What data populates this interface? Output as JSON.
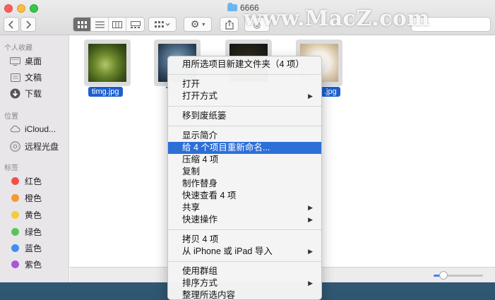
{
  "window": {
    "title": "6666",
    "watermark": "www.MacZ.com"
  },
  "toolbar": {
    "back_icon": "chevron-left-icon",
    "forward_icon": "chevron-right-icon",
    "view_modes": [
      "icon-view-icon",
      "list-view-icon",
      "column-view-icon",
      "gallery-view-icon"
    ],
    "active_view": 0
  },
  "sidebar": {
    "favorites_header": "个人收藏",
    "favorites": [
      {
        "label": "桌面",
        "icon": "desktop-icon"
      },
      {
        "label": "文稿",
        "icon": "document-icon"
      },
      {
        "label": "下载",
        "icon": "download-icon"
      }
    ],
    "locations_header": "位置",
    "locations": [
      {
        "label": "iCloud...",
        "icon": "cloud-icon"
      },
      {
        "label": "远程光盘",
        "icon": "disc-icon"
      }
    ],
    "tags_header": "标签",
    "tags": [
      {
        "label": "红色",
        "color": "#f1504a"
      },
      {
        "label": "橙色",
        "color": "#f59a2f"
      },
      {
        "label": "黄色",
        "color": "#f3cd3b"
      },
      {
        "label": "绿色",
        "color": "#5ac45a"
      },
      {
        "label": "蓝色",
        "color": "#3f8ef0"
      },
      {
        "label": "紫色",
        "color": "#a857d6"
      }
    ]
  },
  "files": [
    {
      "label": "timg.jpg"
    },
    {
      "label": ""
    },
    {
      "label": ""
    },
    {
      "label": ".jpg"
    }
  ],
  "context_menu": {
    "new_folder": "用所选项目新建文件夹（4 项）",
    "open": "打开",
    "open_with": "打开方式",
    "move_to_trash": "移到废纸篓",
    "get_info": "显示简介",
    "rename": "给 4 个项目重新命名...",
    "compress": "压缩 4 项",
    "duplicate": "复制",
    "make_alias": "制作替身",
    "quick_look": "快速查看 4 项",
    "share": "共享",
    "quick_actions": "快速操作",
    "copy": "拷贝 4 项",
    "import_from_iphone": "从 iPhone 或 iPad 导入",
    "use_groups": "使用群组",
    "sort_by": "排序方式",
    "clean_up_selection": "整理所选内容"
  },
  "status": {
    "icon_size_level": 0.2
  }
}
